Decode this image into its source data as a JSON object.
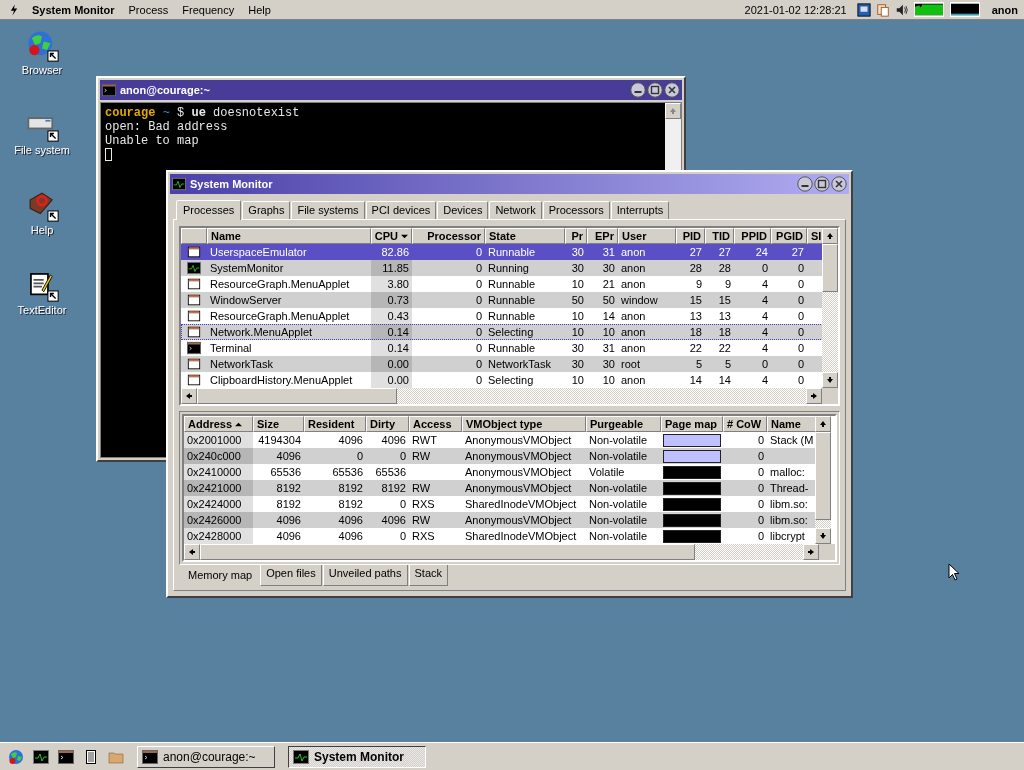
{
  "menubar": {
    "app_name": "System Monitor",
    "menus": [
      "Process",
      "Frequency",
      "Help"
    ],
    "clock": "2021-01-02 12:28:21",
    "user": "anon"
  },
  "desktop_icons": [
    {
      "label": "Browser",
      "kind": "browser"
    },
    {
      "label": "File system",
      "kind": "drive"
    },
    {
      "label": "Help",
      "kind": "help"
    },
    {
      "label": "TextEditor",
      "kind": "editor"
    }
  ],
  "terminal": {
    "title": "anon@courage:~",
    "active": false,
    "prompt": {
      "host": "courage",
      "path": "~",
      "symbol": "$",
      "command": "ue",
      "args": "doesnotexist"
    },
    "output": [
      "open: Bad address",
      "Unable to map"
    ]
  },
  "system_monitor": {
    "title": "System Monitor",
    "active": true,
    "tabs": [
      {
        "label": "Processes",
        "selected": true
      },
      {
        "label": "Graphs",
        "selected": false
      },
      {
        "label": "File systems",
        "selected": false
      },
      {
        "label": "PCI devices",
        "selected": false
      },
      {
        "label": "Devices",
        "selected": false
      },
      {
        "label": "Network",
        "selected": false
      },
      {
        "label": "Processors",
        "selected": false
      },
      {
        "label": "Interrupts",
        "selected": false
      }
    ],
    "process_table": {
      "columns": [
        {
          "label": "Name",
          "kind": "plain"
        },
        {
          "label": "CPU",
          "kind": "sorted_desc"
        },
        {
          "label": "Processor",
          "kind": "plain"
        },
        {
          "label": "State",
          "kind": "plain"
        },
        {
          "label": "Pr",
          "kind": "plain"
        },
        {
          "label": "EPr",
          "kind": "plain"
        },
        {
          "label": "User",
          "kind": "plain"
        },
        {
          "label": "PID",
          "kind": "plain"
        },
        {
          "label": "TID",
          "kind": "plain"
        },
        {
          "label": "PPID",
          "kind": "plain"
        },
        {
          "label": "PGID",
          "kind": "plain"
        },
        {
          "label": "SI",
          "kind": "plain"
        }
      ],
      "rows": [
        {
          "kind": "window",
          "selected": true,
          "focused": false,
          "cells": [
            "UserspaceEmulator",
            "82.86",
            "0",
            "Runnable",
            "30",
            "31",
            "anon",
            "27",
            "27",
            "24",
            "27"
          ]
        },
        {
          "kind": "graph",
          "selected": false,
          "focused": false,
          "cells": [
            "SystemMonitor",
            "11.85",
            "0",
            "Running",
            "30",
            "30",
            "anon",
            "28",
            "28",
            "0",
            "0"
          ]
        },
        {
          "kind": "window",
          "selected": false,
          "focused": false,
          "cells": [
            "ResourceGraph.MenuApplet",
            "3.80",
            "0",
            "Runnable",
            "10",
            "21",
            "anon",
            "9",
            "9",
            "4",
            "0"
          ]
        },
        {
          "kind": "window",
          "selected": false,
          "focused": false,
          "cells": [
            "WindowServer",
            "0.73",
            "0",
            "Runnable",
            "50",
            "50",
            "window",
            "15",
            "15",
            "4",
            "0"
          ]
        },
        {
          "kind": "window",
          "selected": false,
          "focused": false,
          "cells": [
            "ResourceGraph.MenuApplet",
            "0.43",
            "0",
            "Runnable",
            "10",
            "14",
            "anon",
            "13",
            "13",
            "4",
            "0"
          ]
        },
        {
          "kind": "window",
          "selected": false,
          "focused": true,
          "cells": [
            "Network.MenuApplet",
            "0.14",
            "0",
            "Selecting",
            "10",
            "10",
            "anon",
            "18",
            "18",
            "4",
            "0"
          ]
        },
        {
          "kind": "terminal",
          "selected": false,
          "focused": false,
          "cells": [
            "Terminal",
            "0.14",
            "0",
            "Runnable",
            "30",
            "31",
            "anon",
            "22",
            "22",
            "4",
            "0"
          ]
        },
        {
          "kind": "window",
          "selected": false,
          "focused": false,
          "cells": [
            "NetworkTask",
            "0.00",
            "0",
            "NetworkTask",
            "30",
            "30",
            "root",
            "5",
            "5",
            "0",
            "0"
          ]
        },
        {
          "kind": "window",
          "selected": false,
          "focused": false,
          "cells": [
            "ClipboardHistory.MenuApplet",
            "0.00",
            "0",
            "Selecting",
            "10",
            "10",
            "anon",
            "14",
            "14",
            "4",
            "0"
          ]
        }
      ]
    },
    "memory_table": {
      "columns": [
        {
          "label": "Address",
          "kind": "sorted_asc"
        },
        {
          "label": "Size",
          "kind": "plain"
        },
        {
          "label": "Resident",
          "kind": "plain"
        },
        {
          "label": "Dirty",
          "kind": "plain"
        },
        {
          "label": "Access",
          "kind": "plain"
        },
        {
          "label": "VMObject type",
          "kind": "plain"
        },
        {
          "label": "Purgeable",
          "kind": "plain"
        },
        {
          "label": "Page map",
          "kind": "plain"
        },
        {
          "label": "# CoW",
          "kind": "plain"
        },
        {
          "label": "Name",
          "kind": "plain"
        }
      ],
      "rows": [
        {
          "color": "#c0c0ff",
          "cells": [
            "0x2001000",
            "4194304",
            "4096",
            "4096",
            "RWT",
            "AnonymousVMObject",
            "Non-volatile",
            "0",
            "Stack (M"
          ]
        },
        {
          "color": "#c0c0ff",
          "cells": [
            "0x240c000",
            "4096",
            "0",
            "0",
            "RW",
            "AnonymousVMObject",
            "Non-volatile",
            "0",
            ""
          ]
        },
        {
          "color": "#000000",
          "cells": [
            "0x2410000",
            "65536",
            "65536",
            "65536",
            "",
            "AnonymousVMObject",
            "Volatile",
            "0",
            "malloc:"
          ]
        },
        {
          "color": "#000000",
          "cells": [
            "0x2421000",
            "8192",
            "8192",
            "8192",
            "RW",
            "AnonymousVMObject",
            "Non-volatile",
            "0",
            "Thread-"
          ]
        },
        {
          "color": "#000000",
          "cells": [
            "0x2424000",
            "8192",
            "8192",
            "0",
            "RXS",
            "SharedInodeVMObject",
            "Non-volatile",
            "0",
            "libm.so:"
          ]
        },
        {
          "color": "#000000",
          "cells": [
            "0x2426000",
            "4096",
            "4096",
            "4096",
            "RW",
            "AnonymousVMObject",
            "Non-volatile",
            "0",
            "libm.so:"
          ]
        },
        {
          "color": "#000000",
          "cells": [
            "0x2428000",
            "4096",
            "4096",
            "0",
            "RXS",
            "SharedInodeVMObject",
            "Non-volatile",
            "0",
            "libcrypt"
          ]
        }
      ]
    },
    "detail_tabs": [
      {
        "label": "Memory map",
        "selected": true
      },
      {
        "label": "Open files",
        "selected": false
      },
      {
        "label": "Unveiled paths",
        "selected": false
      },
      {
        "label": "Stack",
        "selected": false
      }
    ]
  },
  "taskbar": {
    "launchers": [
      {
        "kind": "browser"
      },
      {
        "kind": "graph"
      },
      {
        "kind": "terminal"
      },
      {
        "kind": "notepad"
      },
      {
        "kind": "folder"
      }
    ],
    "tasks": [
      {
        "title": "anon@courage:~",
        "kind": "terminal",
        "selected": false
      },
      {
        "title": "System Monitor",
        "kind": "graph",
        "selected": true
      }
    ]
  }
}
